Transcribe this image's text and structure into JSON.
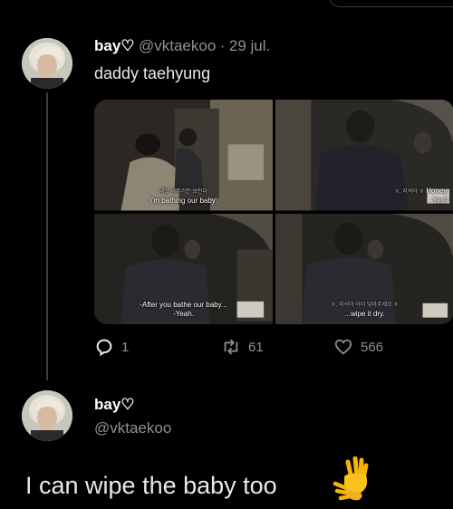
{
  "tweet": {
    "display_name": "bay♡",
    "handle": "@vktaekoo",
    "separator": "·",
    "date": "29 jul.",
    "text": "daddy taehyung",
    "media": [
      {
        "subtitle_korean": "내도 아무거든 보인다",
        "subtitle": "I'm bathing our baby."
      },
      {
        "subtitle_korean": "ㅎ, 지석아 ㅎ",
        "subtitle": "Honey.",
        "subtitle2": "-Yes?"
      },
      {
        "subtitle": "-After you bathe our baby...",
        "subtitle2": "-Yeah."
      },
      {
        "subtitle_korean": "ㅎ, 지석아 아이 닦아주세요 ㅎ",
        "subtitle": "...wipe it dry."
      }
    ],
    "replies": "1",
    "retweets": "61",
    "likes": "566"
  },
  "reply": {
    "display_name": "bay♡",
    "handle": "@vktaekoo",
    "text": "I can wipe the baby too",
    "emoji": "waving-hands-emoji"
  },
  "colors": {
    "background": "#000000",
    "text": "#e7e9ea",
    "muted": "#8b9197",
    "line": "#3a3d40"
  }
}
